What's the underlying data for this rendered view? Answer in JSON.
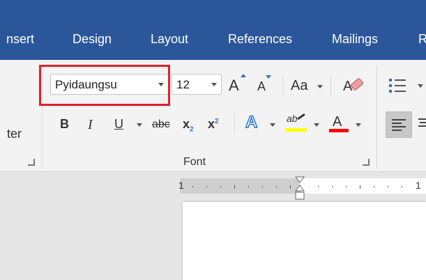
{
  "tabs": {
    "insert": "nsert",
    "design": "Design",
    "layout": "Layout",
    "references": "References",
    "mailings": "Mailings",
    "review": "R"
  },
  "clipboard": {
    "partial_label": "ter"
  },
  "font_group": {
    "font_name": "Pyidaungsu",
    "font_size": "12",
    "grow_label": "A",
    "shrink_label": "A",
    "change_case_label": "Aa",
    "bold_label": "B",
    "italic_label": "I",
    "underline_label": "U",
    "strike_label": "abc",
    "subscript_label": "x",
    "subscript_mark": "2",
    "superscript_label": "x",
    "superscript_mark": "2",
    "text_effects_label": "A",
    "highlight_label": "ab",
    "font_color_label": "A",
    "group_label": "Font"
  },
  "ruler": {
    "left_number": "1",
    "right_number": "1"
  },
  "colors": {
    "ribbon_blue": "#2b579a",
    "highlight_red": "#e0202a",
    "highlight_yellow": "#ffff00",
    "font_color_red": "#ff0000",
    "icon_blue": "#2b74c7"
  }
}
